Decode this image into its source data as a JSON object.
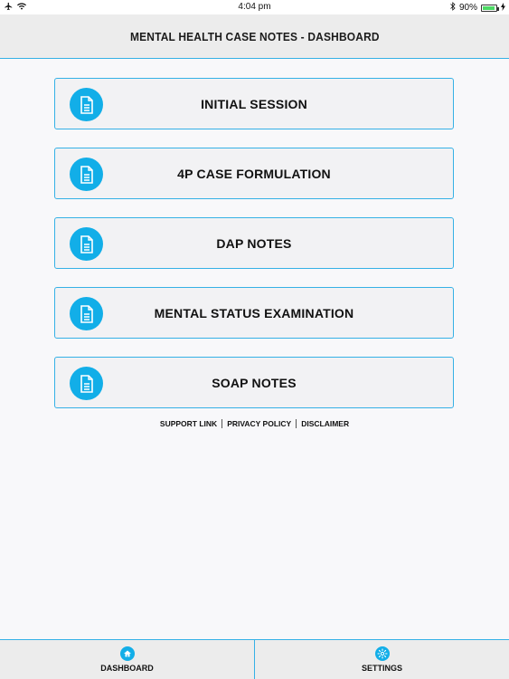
{
  "status_bar": {
    "time": "4:04 pm",
    "battery": "90%",
    "battery_level": 0.9,
    "icons": [
      "airplane-icon",
      "wifi-icon",
      "bluetooth-icon",
      "battery-icon"
    ]
  },
  "header": {
    "title": "MENTAL HEALTH CASE NOTES - DASHBOARD"
  },
  "menu": {
    "items": [
      {
        "label": "INITIAL SESSION",
        "icon": "document-icon"
      },
      {
        "label": "4P CASE FORMULATION",
        "icon": "document-icon"
      },
      {
        "label": "DAP NOTES",
        "icon": "document-icon"
      },
      {
        "label": "MENTAL STATUS EXAMINATION",
        "icon": "document-icon"
      },
      {
        "label": "SOAP NOTES",
        "icon": "document-icon"
      }
    ]
  },
  "footer_links": {
    "support": "SUPPORT LINK",
    "privacy": "PRIVACY POLICY",
    "disclaimer": "DISCLAIMER"
  },
  "tab_bar": {
    "tabs": [
      {
        "label": "DASHBOARD",
        "icon": "home-icon"
      },
      {
        "label": "SETTINGS",
        "icon": "gear-icon"
      }
    ]
  },
  "colors": {
    "accent": "#12aee8",
    "border": "#35b1e6",
    "header_bg": "#ececec"
  }
}
